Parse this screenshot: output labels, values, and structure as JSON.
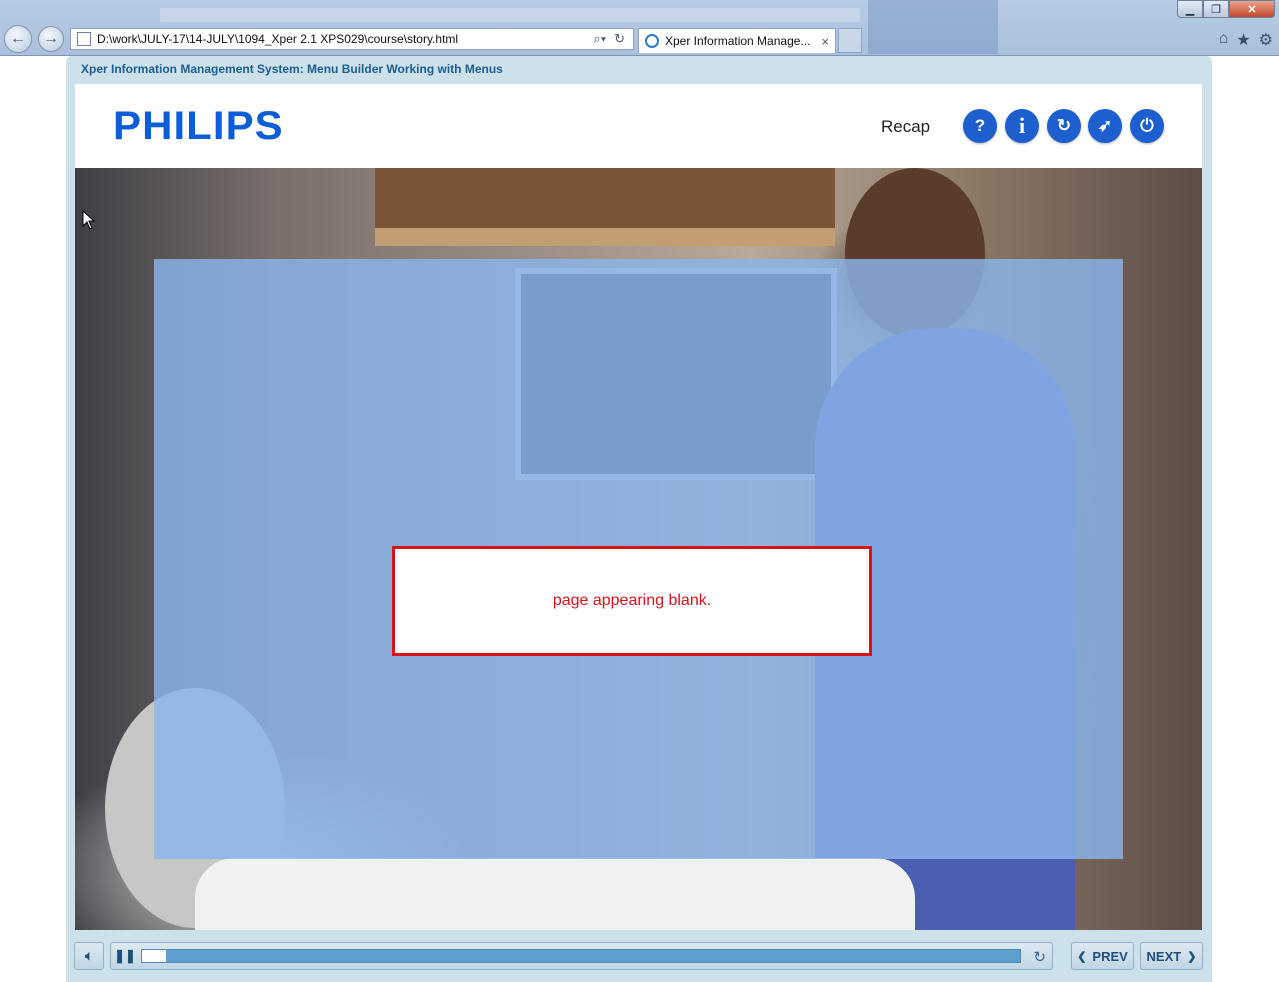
{
  "browser": {
    "address_url": "D:\\work\\JULY-17\\14-JULY\\1094_Xper 2.1 XPS029\\course\\story.html",
    "tab_title": "Xper Information Manage...",
    "tab_close": "×"
  },
  "course": {
    "title": "Xper Information Management System: Menu Builder Working with Menus",
    "logo_text": "PHILIPS",
    "recap_label": "Recap",
    "controls": [
      {
        "name": "help",
        "glyph": "?"
      },
      {
        "name": "info",
        "glyph": "i"
      },
      {
        "name": "replay",
        "glyph": "↻"
      },
      {
        "name": "compass",
        "glyph": "➶"
      },
      {
        "name": "power",
        "glyph": "⏻"
      }
    ]
  },
  "slide": {
    "note_text": "page appearing blank."
  },
  "playbar": {
    "progress": 0.027,
    "prev_label": "PREV",
    "next_label": "NEXT"
  },
  "colors": {
    "brand_blue": "#0b5ed7",
    "button_blue": "#1d5fce",
    "note_red": "#d8121b",
    "overlay_blue": "#8ab4ec"
  }
}
